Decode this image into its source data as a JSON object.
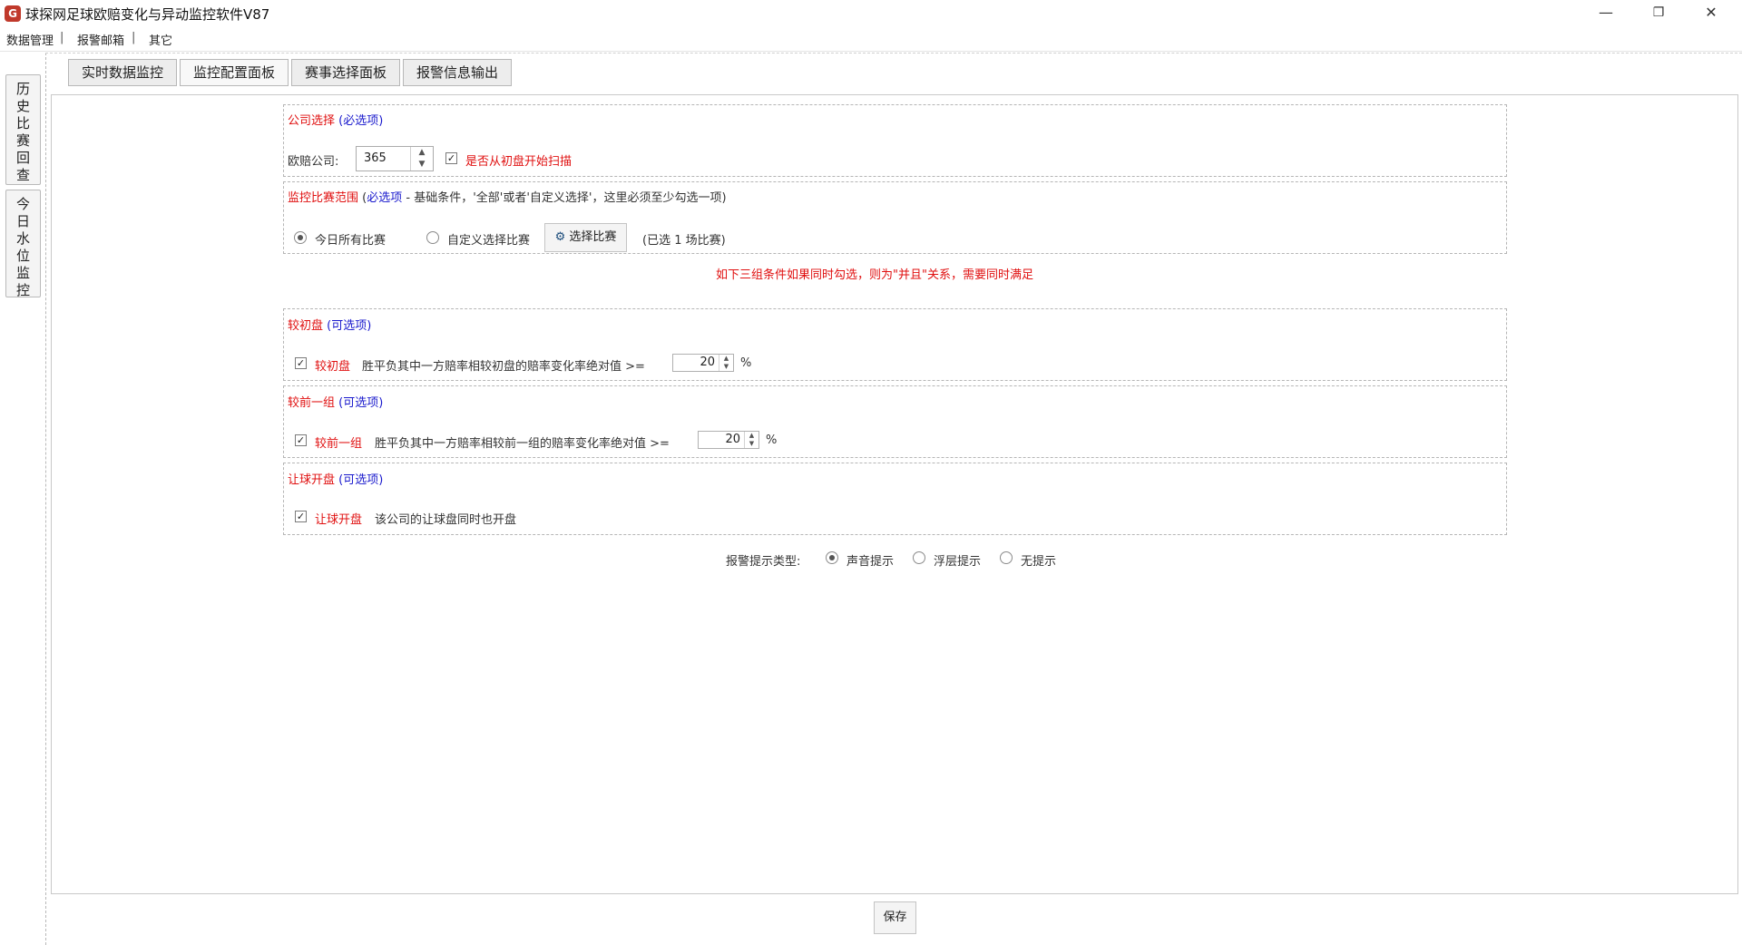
{
  "window": {
    "title": "球探网足球欧赔变化与异动监控软件V87",
    "minimize_glyph": "—",
    "maximize_glyph": "❐",
    "close_glyph": "✕"
  },
  "menu": {
    "items": [
      "数据管理",
      "报警邮箱",
      "其它"
    ],
    "separator": "|"
  },
  "side_tabs": [
    "历史比赛回查",
    "今日水位监控"
  ],
  "tabs": [
    "实时数据监控",
    "监控配置面板",
    "赛事选择面板",
    "报警信息输出"
  ],
  "active_tab": "监控配置面板",
  "company": {
    "title": "公司选择",
    "required": "(必选项)",
    "label": "欧赔公司:",
    "selected": "365",
    "scan_label": "是否从初盘开始扫描",
    "scan_checked": true
  },
  "range": {
    "title": "监控比赛范围",
    "required_prefix": "(",
    "required": "必选项",
    "note": " - 基础条件，'全部'或者'自定义选择'，这里必须至少勾选一项)",
    "option_all": "今日所有比赛",
    "option_custom": "自定义选择比赛",
    "select_button": "选择比赛",
    "selected_info": "(已选 1 场比赛)"
  },
  "notice": "如下三组条件如果同时勾选，则为\"并且\"关系，需要同时满足",
  "initial": {
    "title": "较初盘",
    "optional": "(可选项)",
    "check_label": "较初盘",
    "desc": "胜平负其中一方赔率相较初盘的赔率变化率绝对值 >=",
    "value": "20",
    "unit": "%",
    "checked": true
  },
  "previous": {
    "title": "较前一组",
    "optional": "(可选项)",
    "check_label": "较前一组",
    "desc": "胜平负其中一方赔率相较前一组的赔率变化率绝对值 >=",
    "value": "20",
    "unit": "%",
    "checked": true
  },
  "handicap": {
    "title": "让球开盘",
    "optional": "(可选项)",
    "check_label": "让球开盘",
    "desc": "该公司的让球盘同时也开盘",
    "checked": true
  },
  "alert": {
    "label": "报警提示类型:",
    "options": [
      "声音提示",
      "浮层提示",
      "无提示"
    ],
    "selected": "声音提示"
  },
  "save_button": "保存",
  "colors": {
    "required_red": "#e01010",
    "optional_blue": "#1a1acd"
  }
}
